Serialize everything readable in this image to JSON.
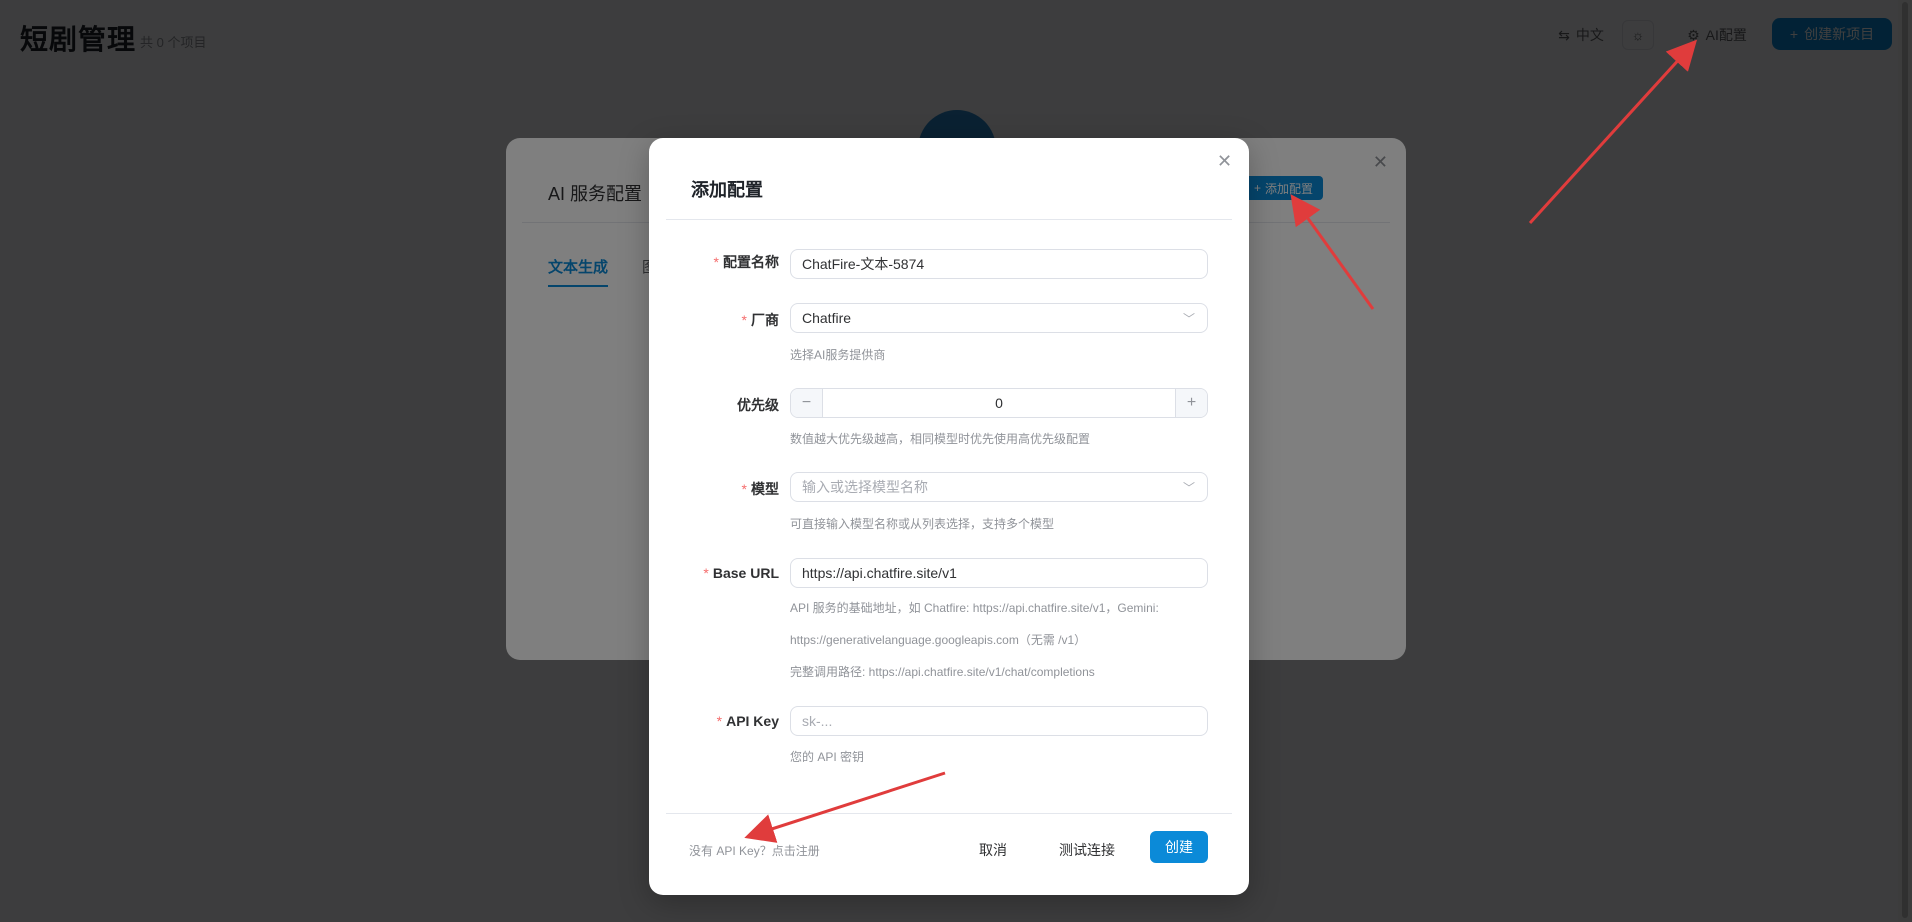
{
  "page": {
    "title": "短剧管理",
    "subtitle": "共 0 个项目",
    "lang_label": "中文",
    "ai_config_label": "AI配置",
    "create_project_label": "创建新项目"
  },
  "ai_service_dialog": {
    "title": "AI 服务配置",
    "add_label": "添加配置",
    "tabs": [
      "文本生成",
      "图"
    ]
  },
  "add_config_dialog": {
    "title": "添加配置",
    "fields": {
      "name": {
        "label": "配置名称",
        "value": "ChatFire-文本-5874"
      },
      "vendor": {
        "label": "厂商",
        "value": "Chatfire",
        "hint": "选择AI服务提供商"
      },
      "priority": {
        "label": "优先级",
        "value": "0",
        "hint": "数值越大优先级越高，相同模型时优先使用高优先级配置"
      },
      "model": {
        "label": "模型",
        "placeholder": "输入或选择模型名称",
        "hint": "可直接输入模型名称或从列表选择，支持多个模型"
      },
      "base_url": {
        "label": "Base URL",
        "value": "https://api.chatfire.site/v1",
        "hint_line1": "API 服务的基础地址，如 Chatfire: https://api.chatfire.site/v1，Gemini:",
        "hint_line2": "https://generativelanguage.googleapis.com（无需 /v1）",
        "hint_line3": "完整调用路径: https://api.chatfire.site/v1/chat/completions"
      },
      "api_key": {
        "label": "API Key",
        "placeholder": "sk-...",
        "hint": "您的 API 密钥"
      }
    },
    "footer": {
      "register_link": "没有 API Key？点击注册",
      "cancel_label": "取消",
      "test_label": "测试连接",
      "create_label": "创建"
    }
  },
  "colors": {
    "primary": "#0b8ad8",
    "required": "#f56c6c",
    "annotation_arrow": "#e03c3c"
  }
}
